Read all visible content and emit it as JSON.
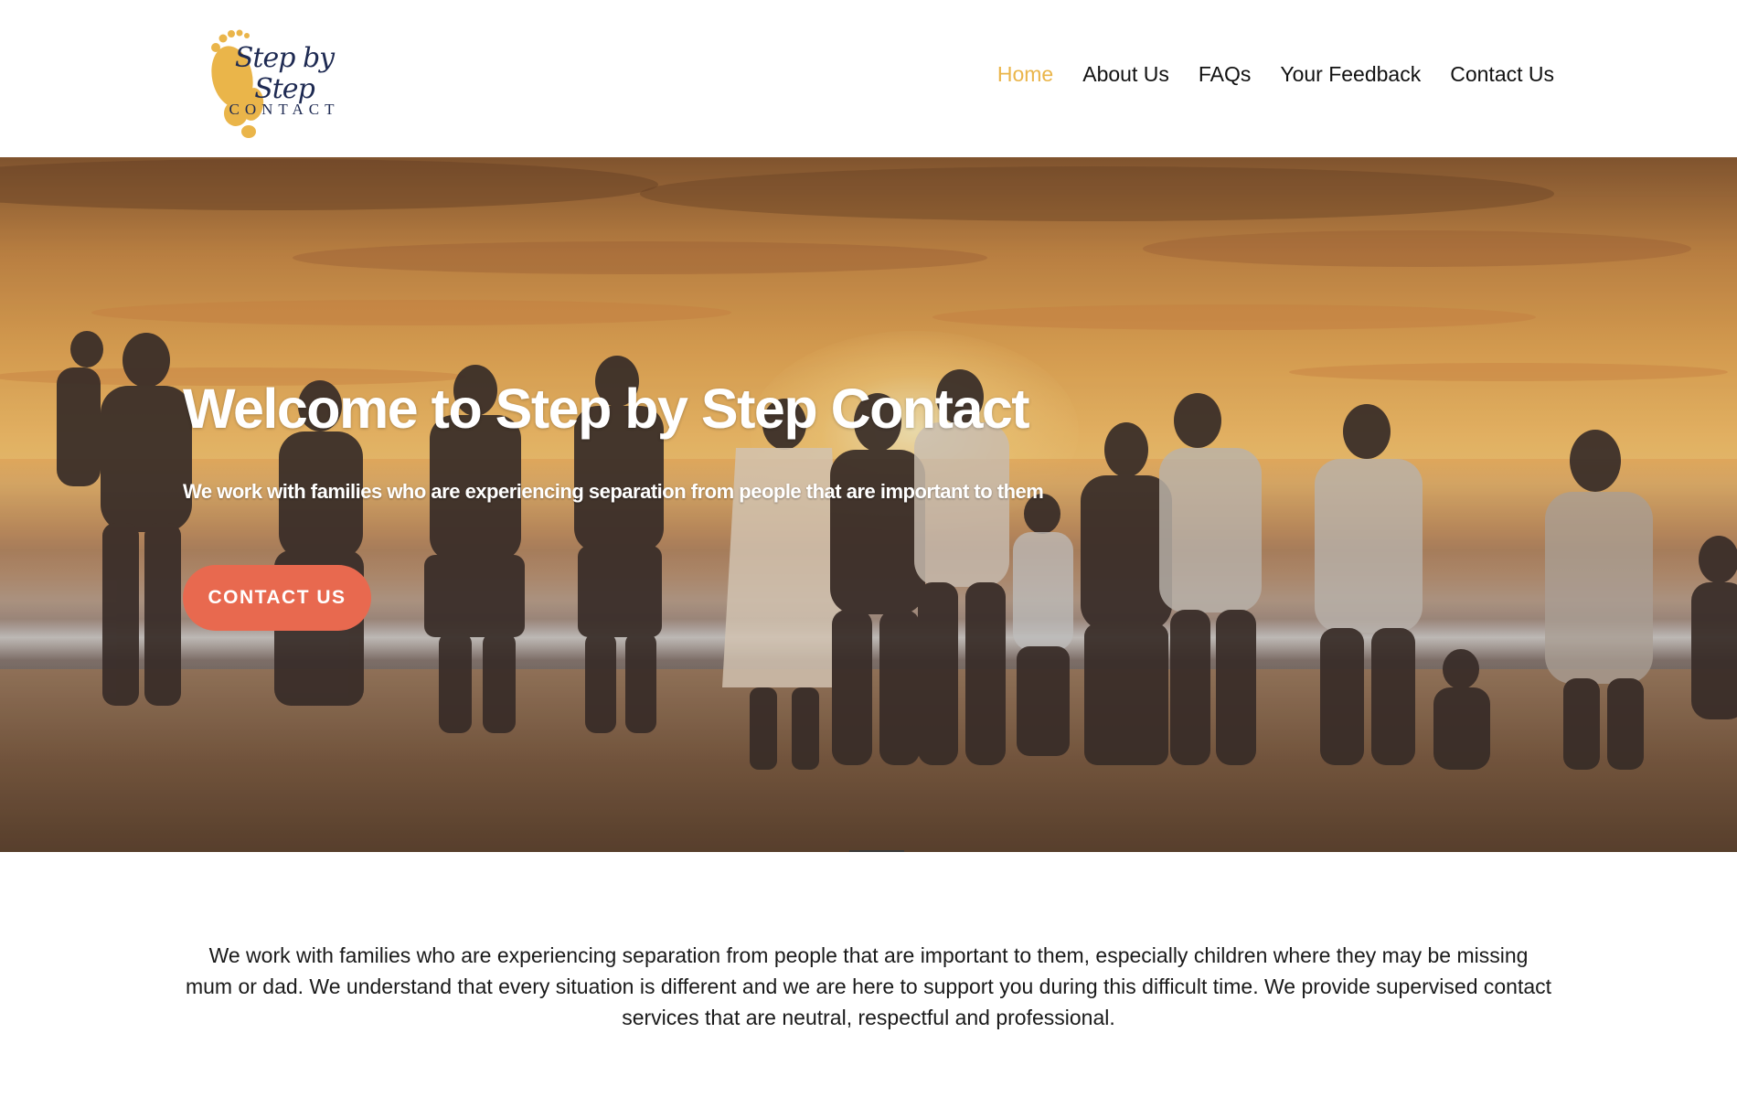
{
  "brand": {
    "logo_script": "Step by Step",
    "logo_caps": "CONTACT",
    "logo_color": "#eab54a",
    "logo_text_color": "#1e2a52"
  },
  "nav": {
    "items": [
      {
        "label": "Home",
        "active": true
      },
      {
        "label": "About Us",
        "active": false
      },
      {
        "label": "FAQs",
        "active": false
      },
      {
        "label": "Your Feedback",
        "active": false
      },
      {
        "label": "Contact Us",
        "active": false
      }
    ],
    "active_color": "#eab54a"
  },
  "hero": {
    "title": "Welcome to Step by Step Contact",
    "subtitle": "We work with families who are experiencing separation from people that are important to them",
    "cta_label": "CONTACT US",
    "cta_color": "#e8694f",
    "image": "family-holding-hands-on-beach-at-sunset"
  },
  "intro": {
    "text": "We work with families who are experiencing separation from people that are important to them, especially children where they may be missing mum or dad. We understand that every situation is different and we are here to support you during this difficult time. We provide supervised contact services that are neutral, respectful and professional."
  }
}
